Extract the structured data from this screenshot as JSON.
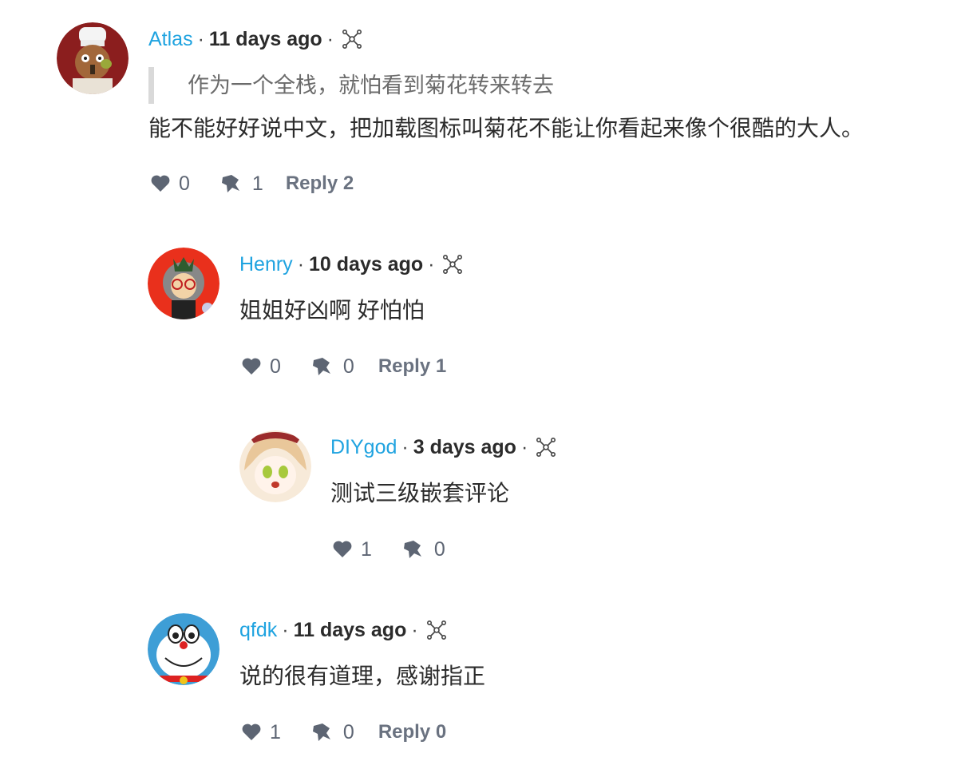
{
  "comments": [
    {
      "author": "Atlas",
      "time": "11 days ago",
      "quote": "作为一个全栈，就怕看到菊花转来转去",
      "text": "能不能好好说中文，把加载图标叫菊花不能让你看起来像个很酷的大人。",
      "likes": "0",
      "dislikes": "1",
      "reply": "Reply 2"
    },
    {
      "author": "Henry",
      "time": "10 days ago",
      "text": "姐姐好凶啊 好怕怕",
      "likes": "0",
      "dislikes": "0",
      "reply": "Reply 1"
    },
    {
      "author": "DIYgod",
      "time": "3 days ago",
      "text": "测试三级嵌套评论",
      "likes": "1",
      "dislikes": "0"
    },
    {
      "author": "qfdk",
      "time": "11 days ago",
      "text": "说的很有道理，感谢指正",
      "likes": "1",
      "dislikes": "0",
      "reply": "Reply 0"
    }
  ],
  "colors": {
    "author": "#1fa3e0",
    "icon": "#5d6573",
    "quote_bar": "#d9d9d9"
  },
  "icons": {
    "like": "heart-icon",
    "dislike": "thumbs-down-icon",
    "network": "network-icon"
  }
}
